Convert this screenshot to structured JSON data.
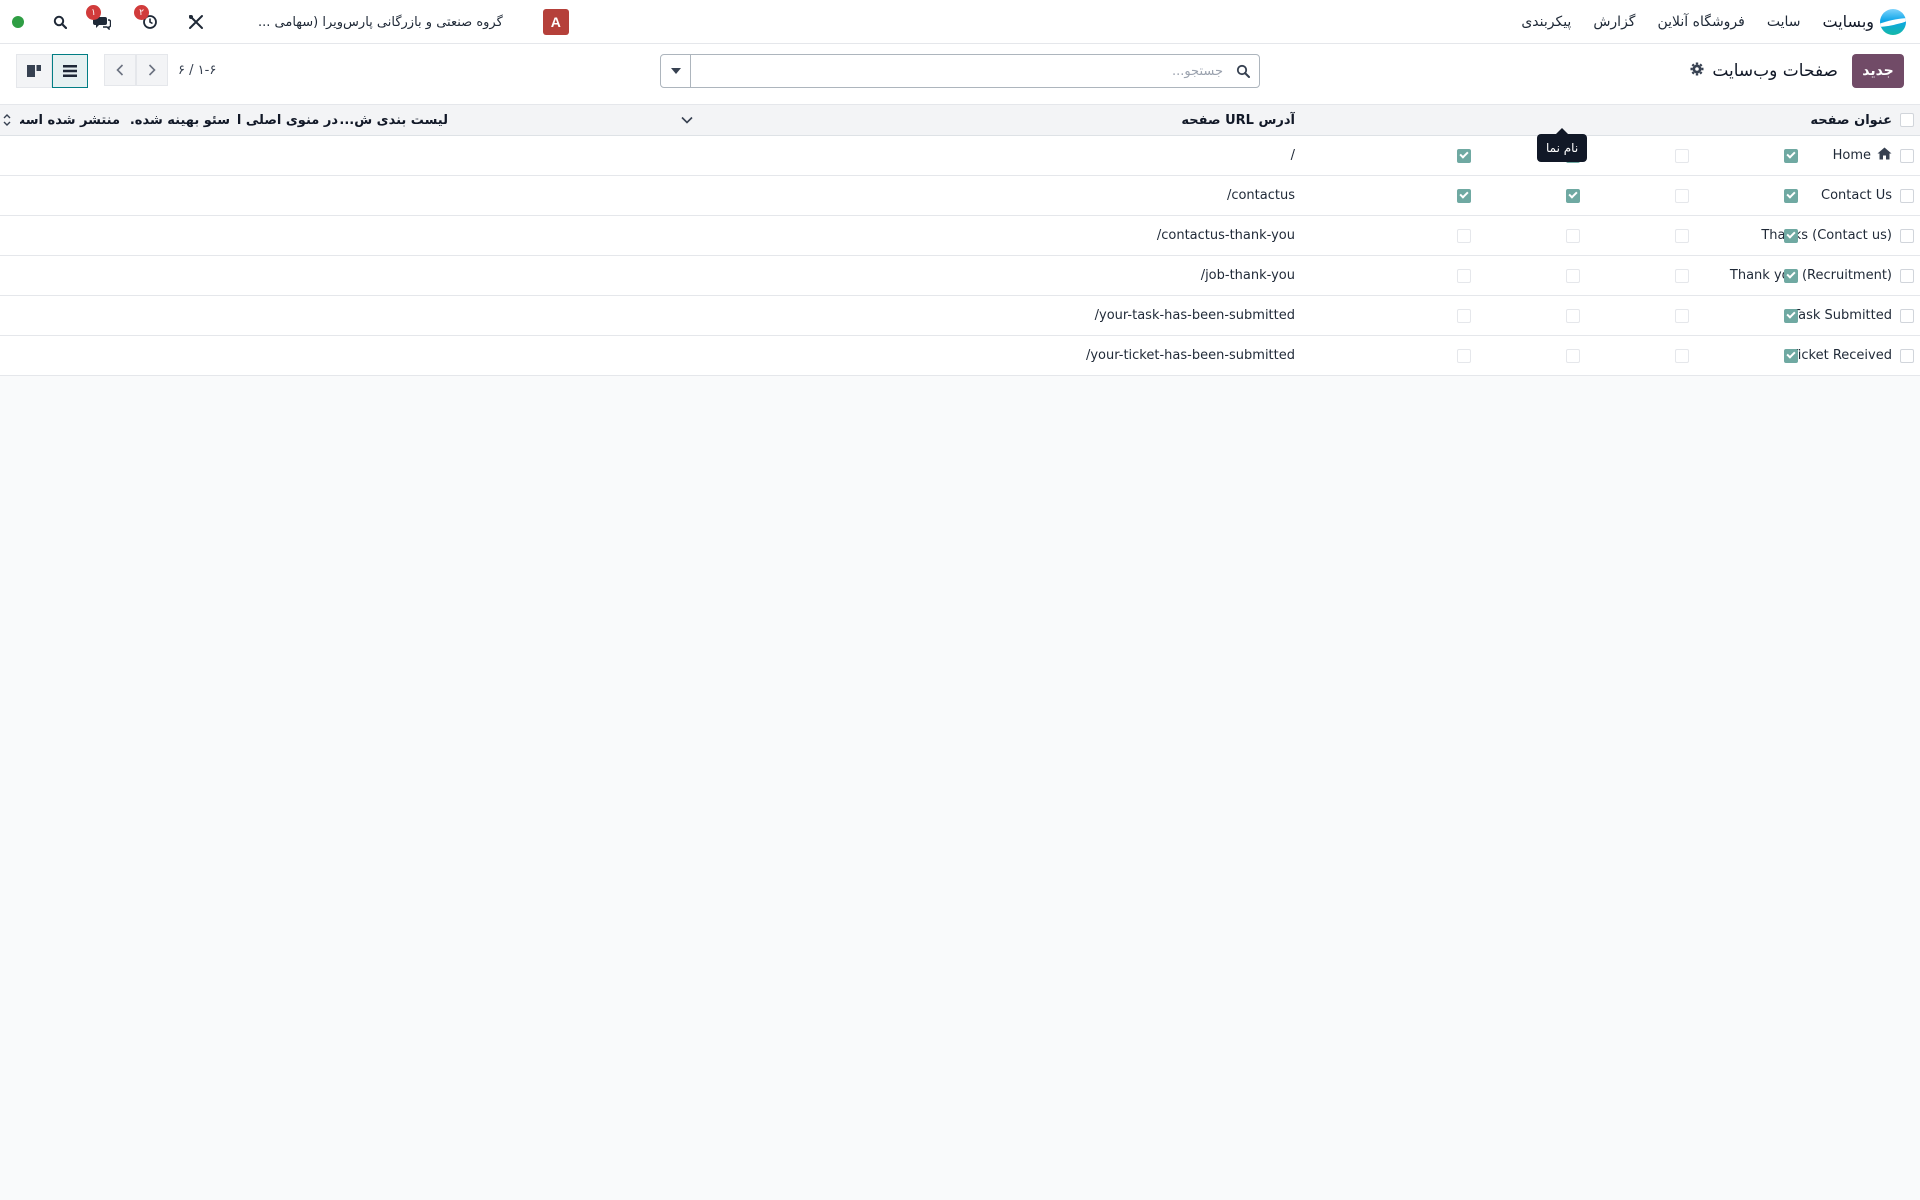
{
  "navbar": {
    "app_name": "وبسایت",
    "menu": [
      "سایت",
      "فروشگاه آنلاین",
      "گزارش",
      "پیکربندی"
    ],
    "company": "گروه صنعتی و بازرگانی پارس‌ویرا (سهامی ...",
    "avatar_letter": "A",
    "activity_badge": "۲",
    "messages_badge": "۱",
    "status_color": "#2f9e44",
    "icons": [
      "tools-icon",
      "clock-icon",
      "chat-icon",
      "search-icon"
    ]
  },
  "control": {
    "new_label": "جدید",
    "title": "صفحات وب‌سایت",
    "search_placeholder": "جستجو...",
    "pager": "۱-۶ / ۶",
    "views": [
      "kanban",
      "list"
    ],
    "active_view": "list"
  },
  "table": {
    "headers": {
      "title": "عنوان صفحه",
      "url": "آدرس URL صفحه",
      "indexed": "لیست بندی ش...",
      "menu": "در منوی اصلی ا...",
      "seo": "سئو بهینه شده...",
      "published": "منتشر شده است"
    },
    "rows": [
      {
        "title": "Home",
        "home": true,
        "url": "/",
        "indexed": true,
        "menu": true,
        "seo": false,
        "published": true
      },
      {
        "title": "Contact Us",
        "home": false,
        "url": "/contactus",
        "indexed": true,
        "menu": true,
        "seo": false,
        "published": true
      },
      {
        "title": "Thanks (Contact us)",
        "home": false,
        "url": "/contactus-thank-you",
        "indexed": false,
        "menu": false,
        "seo": false,
        "published": true
      },
      {
        "title": "Thank you (Recruitment)",
        "home": false,
        "url": "/job-thank-you",
        "indexed": false,
        "menu": false,
        "seo": false,
        "published": true
      },
      {
        "title": "Task Submitted",
        "home": false,
        "url": "/your-task-has-been-submitted",
        "indexed": false,
        "menu": false,
        "seo": false,
        "published": true
      },
      {
        "title": "Ticket Received",
        "home": false,
        "url": "/your-ticket-has-been-submitted",
        "indexed": false,
        "menu": false,
        "seo": false,
        "published": true
      }
    ]
  },
  "tooltip": "نام نما",
  "colors": {
    "brand": "#714b67",
    "checkbox": "#6fa9a2",
    "avatar": "#b5403a",
    "badge": "#d13b3b"
  }
}
